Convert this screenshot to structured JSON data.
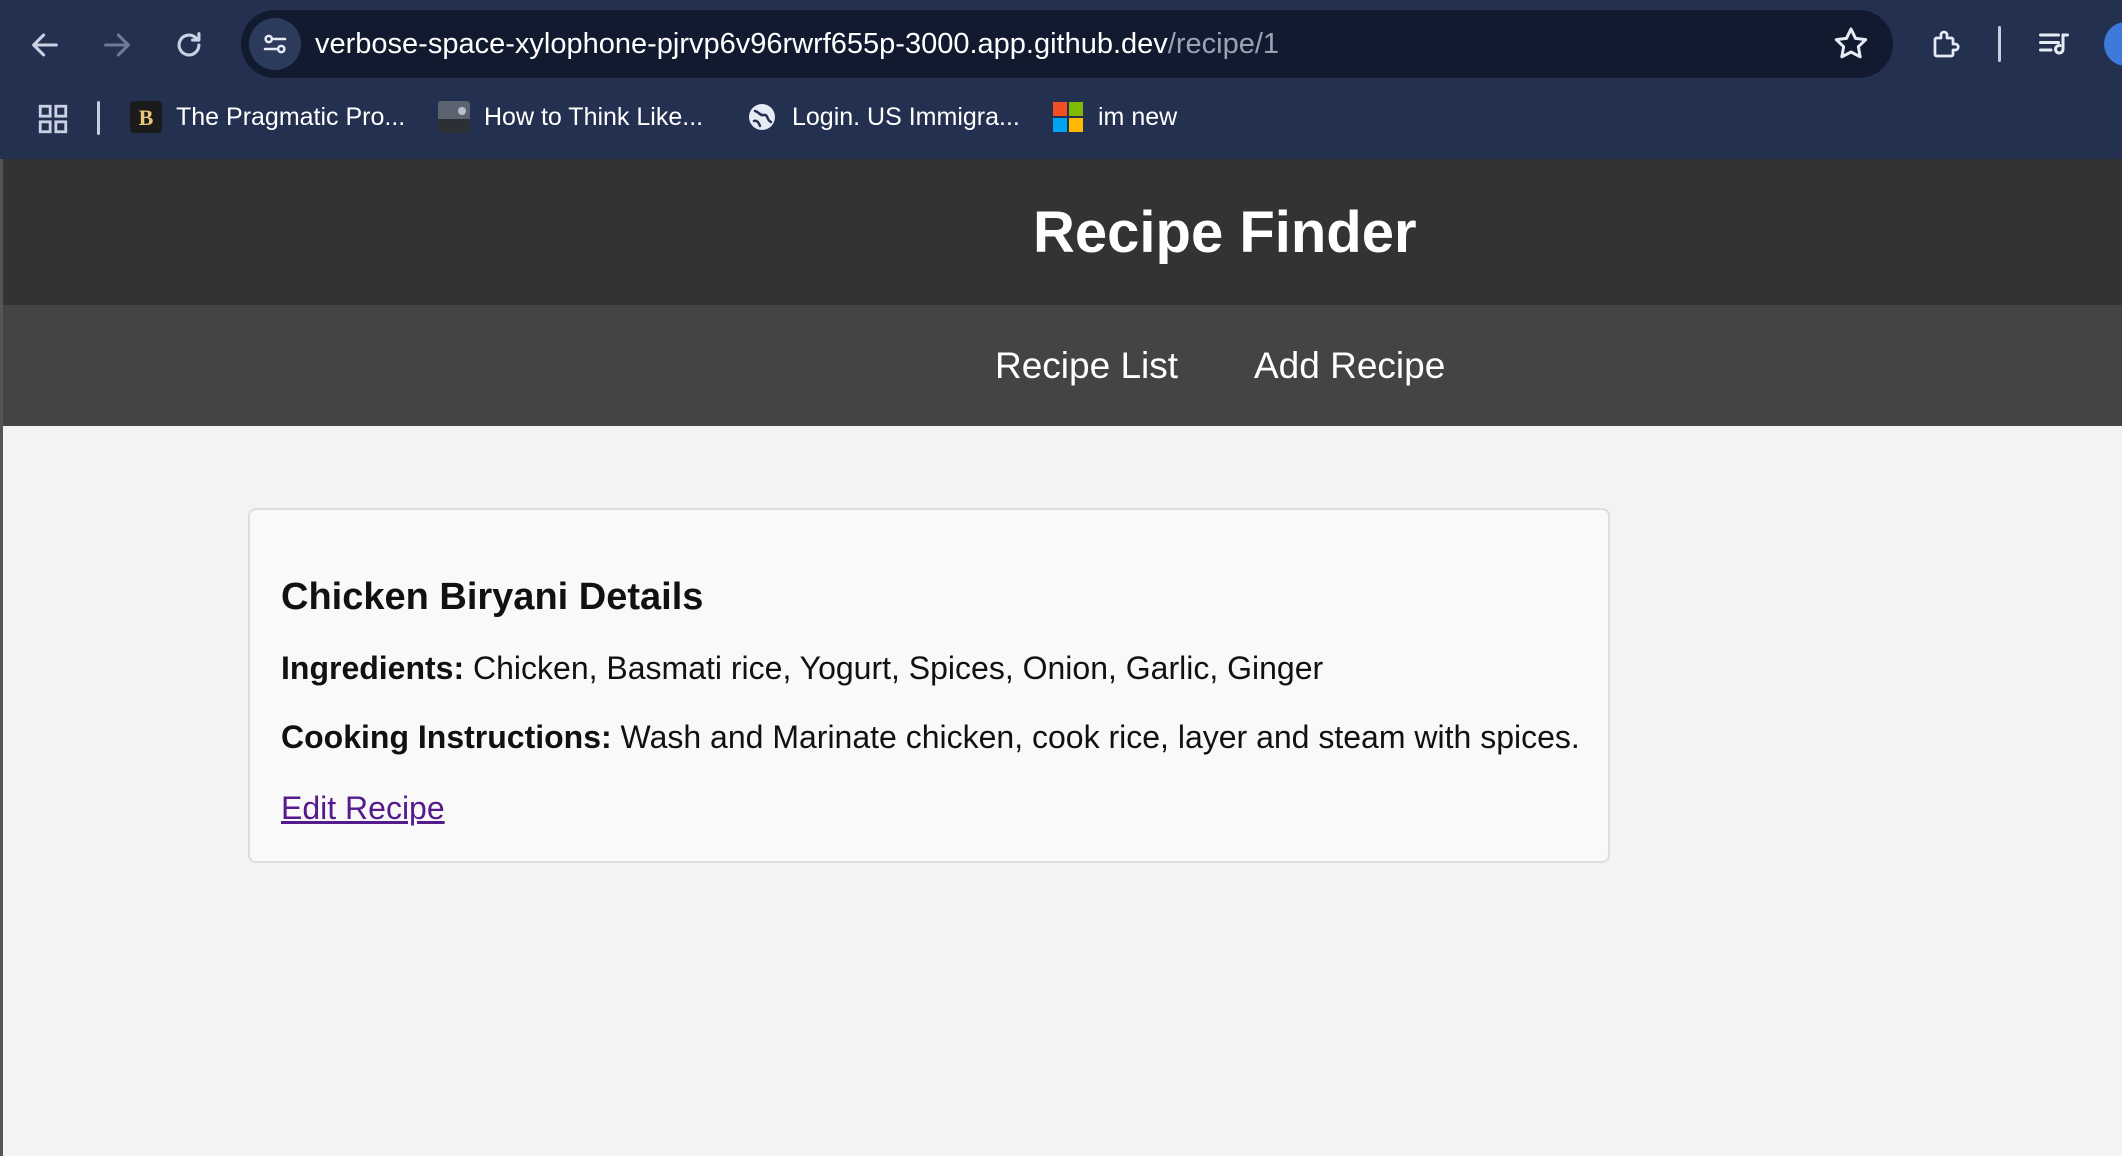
{
  "browser": {
    "url_host": "verbose-space-xylophone-pjrvp6v96rwrf655p-3000.app.github.dev",
    "url_path": "/recipe/1",
    "icons": {
      "back": "arrow-left-icon",
      "forward": "arrow-right-icon",
      "reload": "reload-icon",
      "site_info": "site-settings-icon",
      "bookmark": "star-icon",
      "extensions": "puzzle-icon",
      "media": "media-queue-icon"
    },
    "bookmarks": [
      {
        "label": "The Pragmatic Pro...",
        "icon": "pragmatic-bookshelf-icon"
      },
      {
        "label": "How to Think Like...",
        "icon": "thumbnail-icon"
      },
      {
        "label": "Login. US Immigra...",
        "icon": "globe-icon"
      },
      {
        "label": "im new",
        "icon": "microsoft-icon"
      }
    ]
  },
  "site": {
    "title": "Recipe Finder",
    "nav": [
      {
        "label": "Recipe List"
      },
      {
        "label": "Add Recipe"
      }
    ]
  },
  "recipe": {
    "heading": "Chicken Biryani Details",
    "ingredients_label": "Ingredients:",
    "ingredients": "Chicken, Basmati rice, Yogurt, Spices, Onion, Garlic, Ginger",
    "instructions_label": "Cooking Instructions:",
    "instructions": "Wash and Marinate chicken, cook rice, layer and steam with spices.",
    "edit_link": "Edit Recipe"
  },
  "colors": {
    "browser_frame": "#23304f",
    "header_bg": "#333333",
    "nav_bg": "#444444",
    "visited_link": "#551a8b"
  }
}
